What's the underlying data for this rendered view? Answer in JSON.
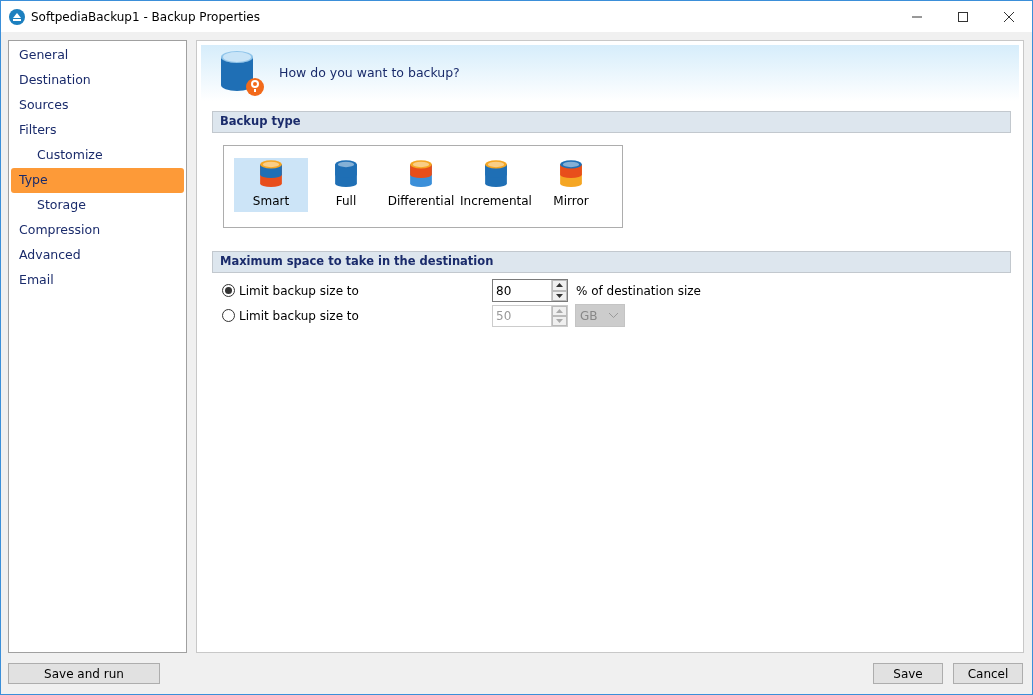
{
  "window": {
    "title": "SoftpediaBackup1 - Backup Properties"
  },
  "sidebar": {
    "items": [
      {
        "label": "General",
        "selected": false
      },
      {
        "label": "Destination",
        "selected": false
      },
      {
        "label": "Sources",
        "selected": false
      },
      {
        "label": "Filters",
        "selected": false,
        "children": [
          {
            "label": "Customize",
            "selected": false
          }
        ]
      },
      {
        "label": "Type",
        "selected": true,
        "children": [
          {
            "label": "Storage",
            "selected": false
          }
        ]
      },
      {
        "label": "Compression",
        "selected": false
      },
      {
        "label": "Advanced",
        "selected": false
      },
      {
        "label": "Email",
        "selected": false
      }
    ]
  },
  "header": {
    "question": "How do you want to backup?"
  },
  "backup_type": {
    "heading": "Backup type",
    "types": [
      {
        "label": "Smart",
        "kind": "smart",
        "selected": true
      },
      {
        "label": "Full",
        "kind": "full",
        "selected": false
      },
      {
        "label": "Differential",
        "kind": "differential",
        "selected": false
      },
      {
        "label": "Incremental",
        "kind": "incremental",
        "selected": false
      },
      {
        "label": "Mirror",
        "kind": "mirror",
        "selected": false
      }
    ]
  },
  "max_space": {
    "heading": "Maximum space to take in the destination",
    "options": [
      {
        "label": "Limit backup size to",
        "selected": true,
        "value": "80",
        "kind": "percent",
        "unit": "% of destination size"
      },
      {
        "label": "Limit backup size to",
        "selected": false,
        "value": "50",
        "kind": "size",
        "unit": "GB"
      }
    ]
  },
  "buttons": {
    "left": [
      "Save and run"
    ],
    "right": [
      "Save",
      "Cancel"
    ]
  }
}
